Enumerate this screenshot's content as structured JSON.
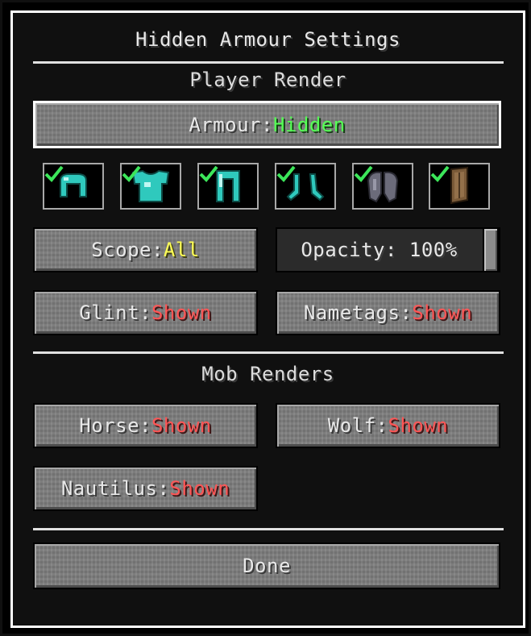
{
  "title": "Hidden Armour Settings",
  "player_render": {
    "heading": "Player Render",
    "armour": {
      "label": "Armour: ",
      "value": "Hidden"
    },
    "slots": [
      {
        "icon": "diamond-helmet-icon",
        "enabled": true
      },
      {
        "icon": "diamond-chestplate-icon",
        "enabled": true
      },
      {
        "icon": "diamond-leggings-icon",
        "enabled": true
      },
      {
        "icon": "diamond-boots-icon",
        "enabled": true
      },
      {
        "icon": "elytra-icon",
        "enabled": true
      },
      {
        "icon": "shield-icon",
        "enabled": true
      }
    ],
    "scope": {
      "label": "Scope: ",
      "value": "All"
    },
    "opacity": {
      "text": "Opacity: 100%",
      "level": 1.0
    },
    "glint": {
      "label": "Glint: ",
      "value": "Shown"
    },
    "nametags": {
      "label": "Nametags: ",
      "value": "Shown"
    }
  },
  "mob_renders": {
    "heading": "Mob Renders",
    "horse": {
      "label": "Horse: ",
      "value": "Shown"
    },
    "wolf": {
      "label": "Wolf: ",
      "value": "Shown"
    },
    "nautilus": {
      "label": "Nautilus: ",
      "value": "Shown"
    }
  },
  "done_label": "Done",
  "colors": {
    "hidden": "#55ff55",
    "all": "#ffff55",
    "shown": "#ff5555",
    "check": "#3ce65a",
    "diamond": "#3fd9cc"
  }
}
